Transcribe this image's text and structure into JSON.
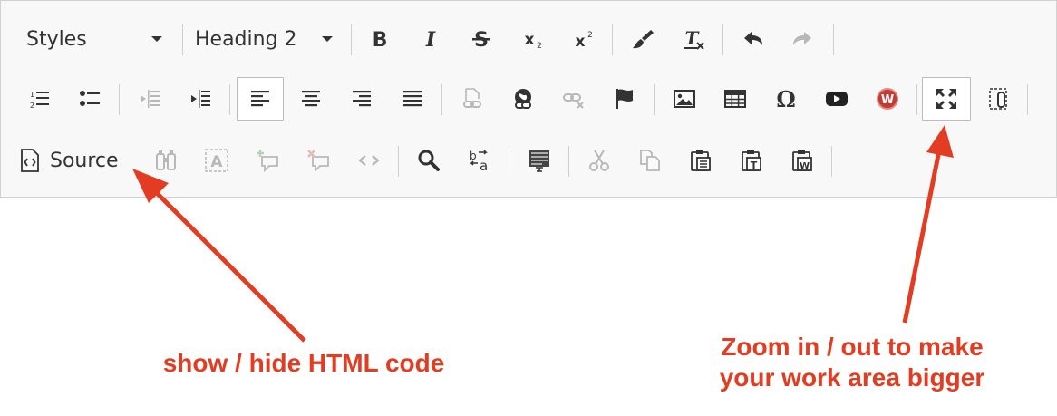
{
  "toolbar": {
    "styles_combo": {
      "value": "Styles"
    },
    "format_combo": {
      "value": "Heading 2"
    },
    "source_label": "Source"
  },
  "annotations": {
    "source_note": "show / hide HTML code",
    "maximize_note_line1": "Zoom in / out to make",
    "maximize_note_line2": "your work area bigger",
    "color": "#e23d22"
  },
  "icons": {
    "row1": [
      "bold-icon",
      "italic-icon",
      "strike-icon",
      "subscript-icon",
      "superscript-icon",
      "copy-format-icon",
      "remove-format-icon",
      "undo-icon",
      "redo-icon"
    ],
    "row2": [
      "numbered-list-icon",
      "bulleted-list-icon",
      "outdent-icon",
      "indent-icon",
      "align-left-icon",
      "align-center-icon",
      "align-right-icon",
      "justify-icon",
      "link-icon",
      "anchor-globe-icon",
      "unlink-icon",
      "flag-icon",
      "image-icon",
      "table-icon",
      "omega-icon",
      "youtube-icon",
      "wiris-icon",
      "maximize-icon",
      "show-blocks-icon"
    ],
    "row3": [
      "source-icon",
      "find-icon",
      "replace-icon",
      "add-comment-icon",
      "remove-comment-icon",
      "code-icon",
      "search-icon",
      "text-direction-icon",
      "paragraph-format-icon",
      "cut-icon",
      "copy-icon",
      "paste-icon",
      "paste-text-icon",
      "paste-word-icon"
    ]
  }
}
